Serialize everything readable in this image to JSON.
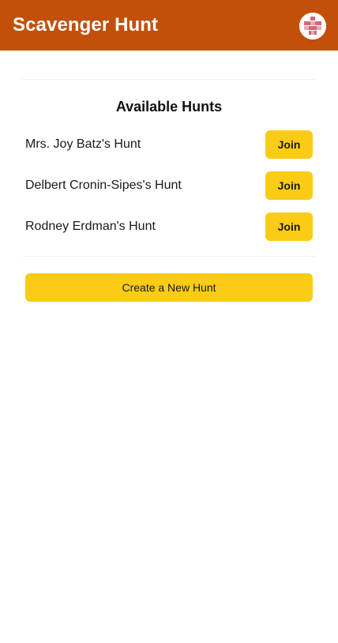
{
  "header": {
    "title": "Scavenger Hunt",
    "avatar_icon": "identicon-avatar",
    "background_color": "#c2500a"
  },
  "main": {
    "section_title": "Available Hunts",
    "hunts": [
      {
        "name": "Mrs. Joy Batz's Hunt",
        "action_label": "Join"
      },
      {
        "name": "Delbert Cronin-Sipes's Hunt",
        "action_label": "Join"
      },
      {
        "name": "Rodney Erdman's Hunt",
        "action_label": "Join"
      }
    ],
    "create_label": "Create a New Hunt",
    "button_color": "#facc15"
  }
}
